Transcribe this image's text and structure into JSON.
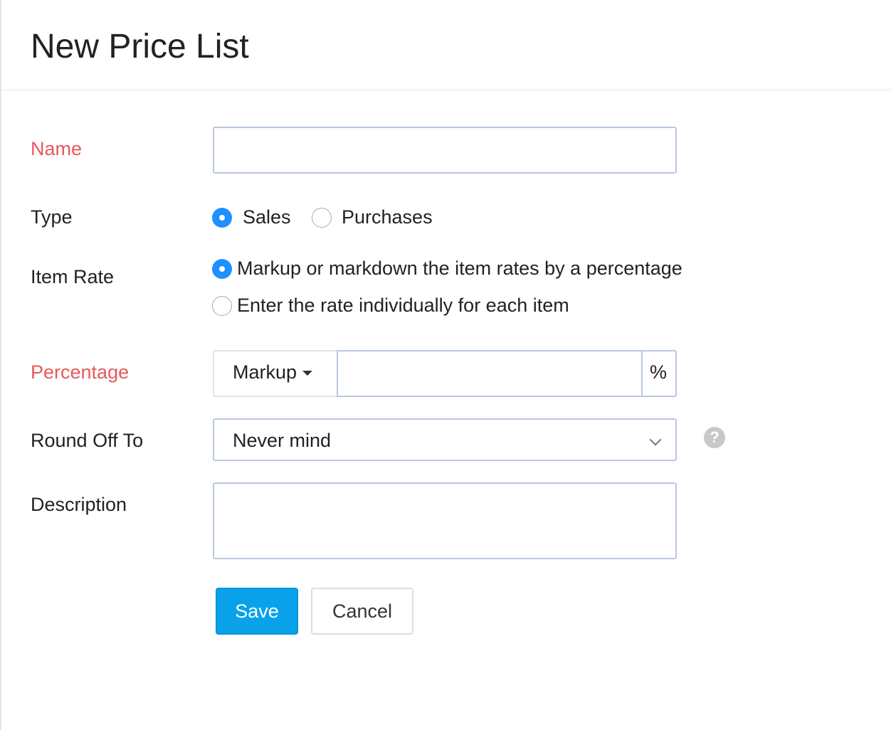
{
  "header": {
    "title": "New Price List"
  },
  "form": {
    "name": {
      "label": "Name",
      "value": ""
    },
    "type": {
      "label": "Type",
      "options": [
        "Sales",
        "Purchases"
      ],
      "selected": "Sales"
    },
    "item_rate": {
      "label": "Item Rate",
      "options": [
        "Markup or markdown the item rates by a percentage",
        "Enter the rate individually for each item"
      ],
      "selected": "Markup or markdown the item rates by a percentage"
    },
    "percentage": {
      "label": "Percentage",
      "mode": "Markup",
      "value": "",
      "suffix": "%"
    },
    "round_off": {
      "label": "Round Off To",
      "value": "Never mind",
      "help_icon": "question-circle-icon"
    },
    "description": {
      "label": "Description",
      "value": ""
    }
  },
  "actions": {
    "save": "Save",
    "cancel": "Cancel"
  },
  "colors": {
    "required_label": "#e8585b",
    "accent": "#08a2ea",
    "radio": "#1e90ff"
  }
}
